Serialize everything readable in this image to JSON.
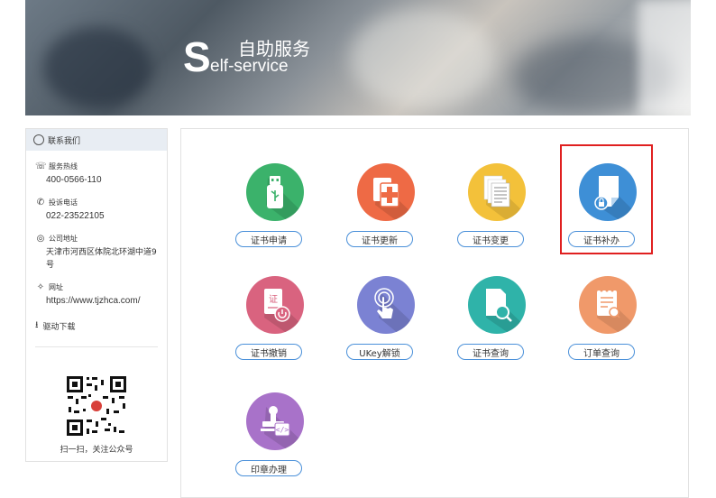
{
  "banner": {
    "letter": "S",
    "title_cn": "自助服务",
    "title_en": "elf-service"
  },
  "sidebar": {
    "header": "联系我们",
    "hotline_label": "服务热线",
    "hotline": "400-0566-110",
    "complaint_label": "投诉电话",
    "complaint": "022-23522105",
    "address_label": "公司地址",
    "address": "天津市河西区体院北环湖中道9号",
    "website_label": "网址",
    "website": "https://www.tjzhca.com/",
    "driver": "驱动下载",
    "qr_caption": "扫一扫，关注公众号"
  },
  "services": [
    {
      "label": "证书申请",
      "color": "#3bb26b",
      "icon": "usb-icon"
    },
    {
      "label": "证书更新",
      "color": "#ee6a45",
      "icon": "document-plus-icon"
    },
    {
      "label": "证书变更",
      "color": "#f3c13a",
      "icon": "documents-icon"
    },
    {
      "label": "证书补办",
      "color": "#3e8fd6",
      "icon": "document-lock-icon"
    },
    {
      "label": "证书撤销",
      "color": "#d9637f",
      "icon": "certificate-power-icon"
    },
    {
      "label": "UKey解锁",
      "color": "#7b82d3",
      "icon": "touch-unlock-icon"
    },
    {
      "label": "证书查询",
      "color": "#2fb3a9",
      "icon": "document-search-icon"
    },
    {
      "label": "订单查询",
      "color": "#f0996a",
      "icon": "order-search-icon"
    },
    {
      "label": "印章办理",
      "color": "#a872c9",
      "icon": "seal-icon"
    }
  ]
}
